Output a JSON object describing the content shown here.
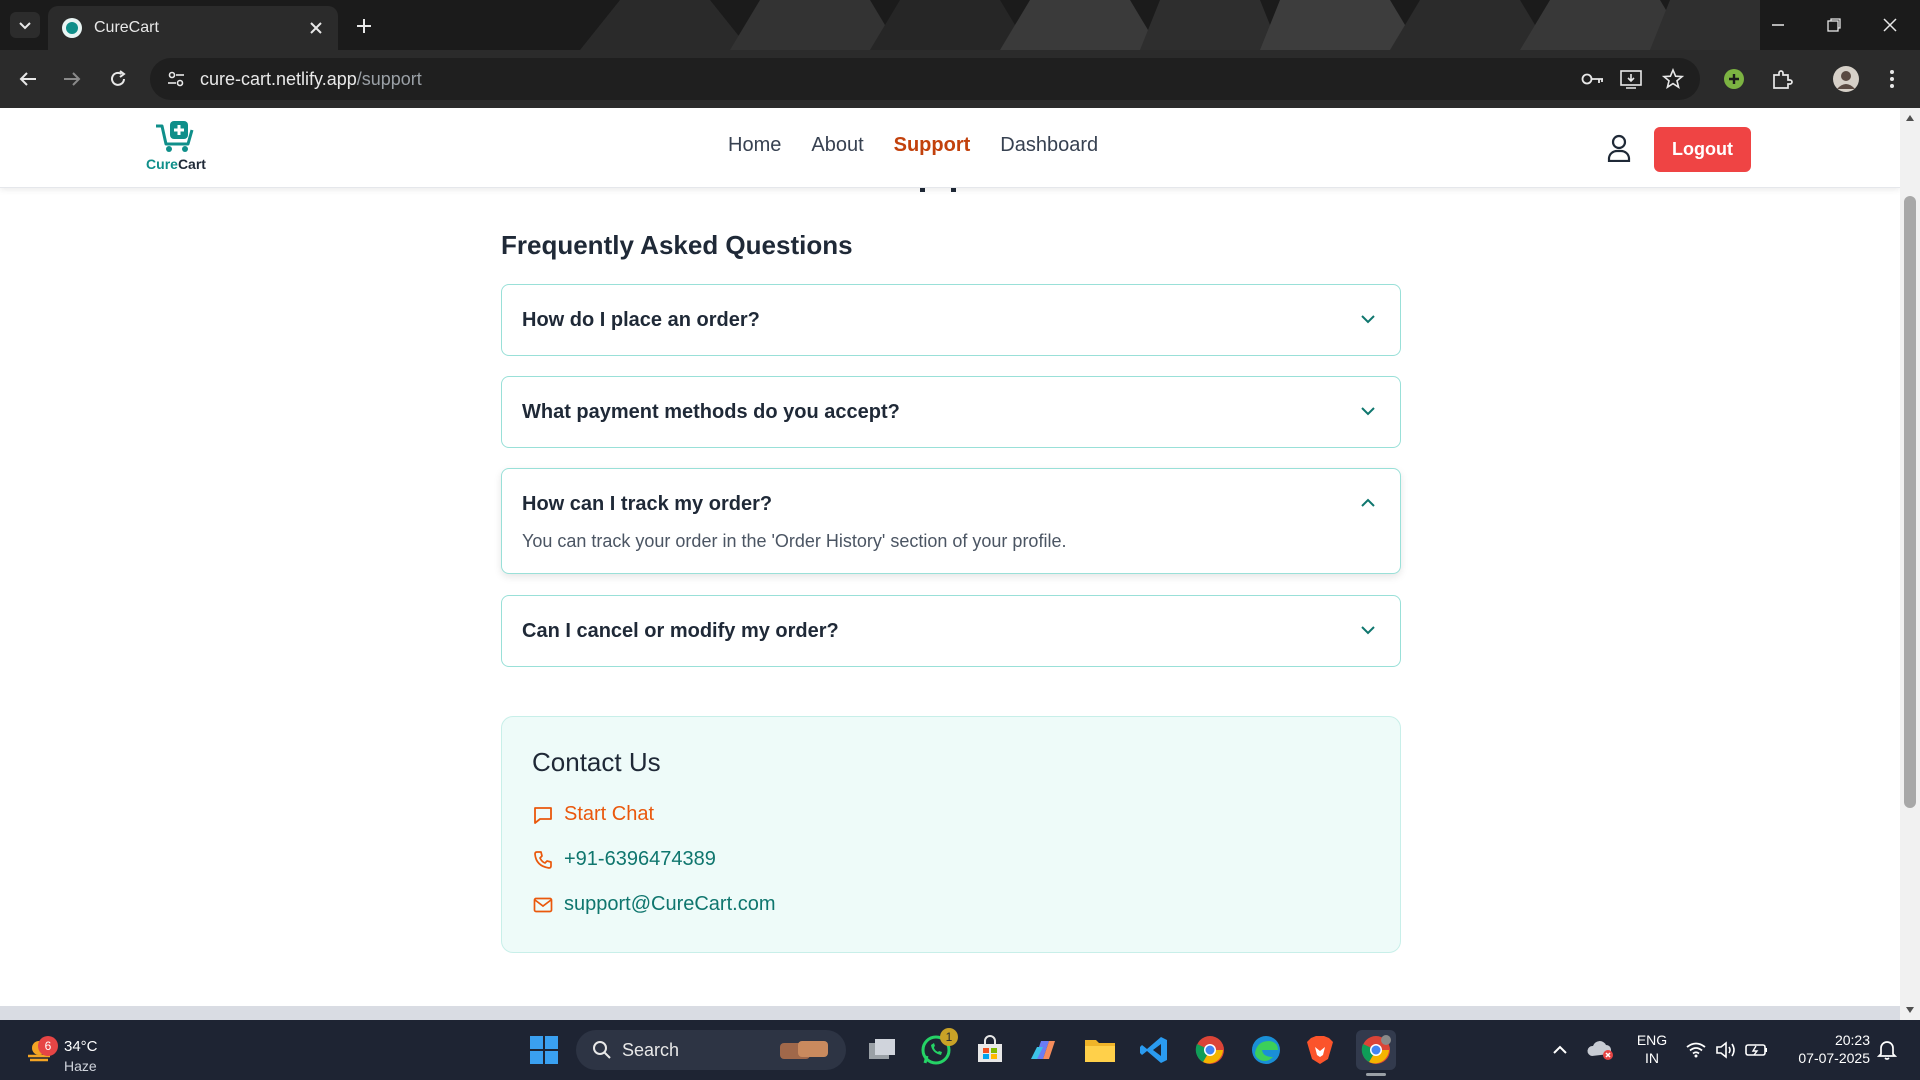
{
  "browser": {
    "tab_title": "CureCart",
    "url_host": "cure-cart.netlify.app",
    "url_path": "/support"
  },
  "site": {
    "logo_part1": "Cure",
    "logo_part2": "Cart",
    "nav": [
      {
        "label": "Home",
        "active": false
      },
      {
        "label": "About",
        "active": false
      },
      {
        "label": "Support",
        "active": true
      },
      {
        "label": "Dashboard",
        "active": false
      }
    ],
    "logout_label": "Logout"
  },
  "faq": {
    "title": "Frequently Asked Questions",
    "items": [
      {
        "question": "How do I place an order?",
        "open": false
      },
      {
        "question": "What payment methods do you accept?",
        "open": false
      },
      {
        "question": "How can I track my order?",
        "open": true,
        "answer": "You can track your order in the 'Order History' section of your profile."
      },
      {
        "question": "Can I cancel or modify my order?",
        "open": false
      }
    ]
  },
  "contact": {
    "title": "Contact Us",
    "chat_label": "Start Chat",
    "phone": "+91-6396474389",
    "email": "support@CureCart.com"
  },
  "colors": {
    "accent_orange": "#c2410c",
    "logout_red": "#ef4444",
    "teal": "#0f766e",
    "faq_border": "#99e0d8",
    "contact_bg": "#eefbf9"
  },
  "taskbar": {
    "weather_badge": "6",
    "temperature": "34°C",
    "condition": "Haze",
    "search_label": "Search",
    "whatsapp_badge": "1",
    "lang_line1": "ENG",
    "lang_line2": "IN",
    "time": "20:23",
    "date": "07-07-2025"
  }
}
